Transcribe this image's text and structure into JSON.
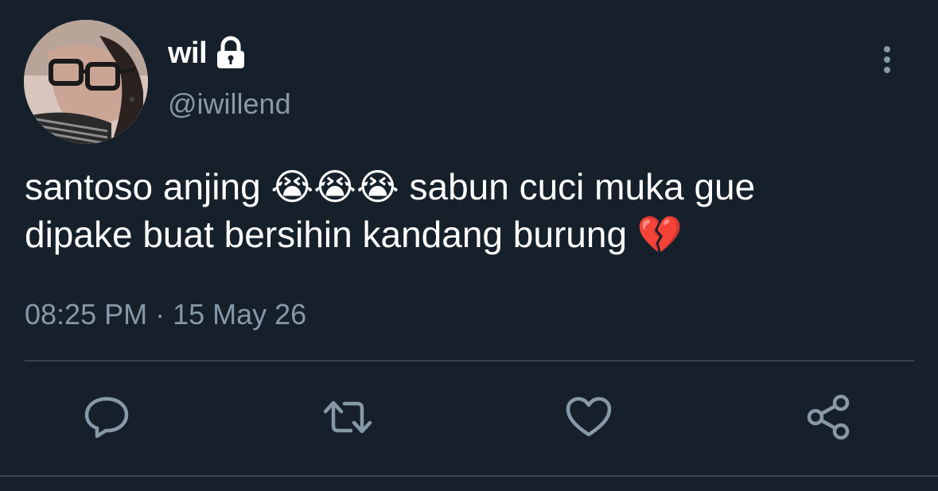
{
  "user": {
    "display_name": "wil",
    "handle": "@iwillend",
    "protected_icon": "lock-icon",
    "avatar_icon": "avatar"
  },
  "tweet": {
    "line1_text": "santoso anjing ",
    "line1_emoji": "😭😭😭",
    "line1_rest": " sabun cuci muka gue",
    "line2_text": "dipake buat bersihin kandang burung ",
    "line2_emoji": "💔",
    "timestamp": "08:25 PM · 15 May 26"
  },
  "actions": {
    "reply_icon": "reply-icon",
    "retweet_icon": "retweet-icon",
    "like_icon": "like-icon",
    "share_icon": "share-icon",
    "more_icon": "more-icon"
  },
  "colors": {
    "background": "#15202b",
    "secondary_text": "#8899a6",
    "divider": "#38444d",
    "icon": "#8899a6"
  }
}
